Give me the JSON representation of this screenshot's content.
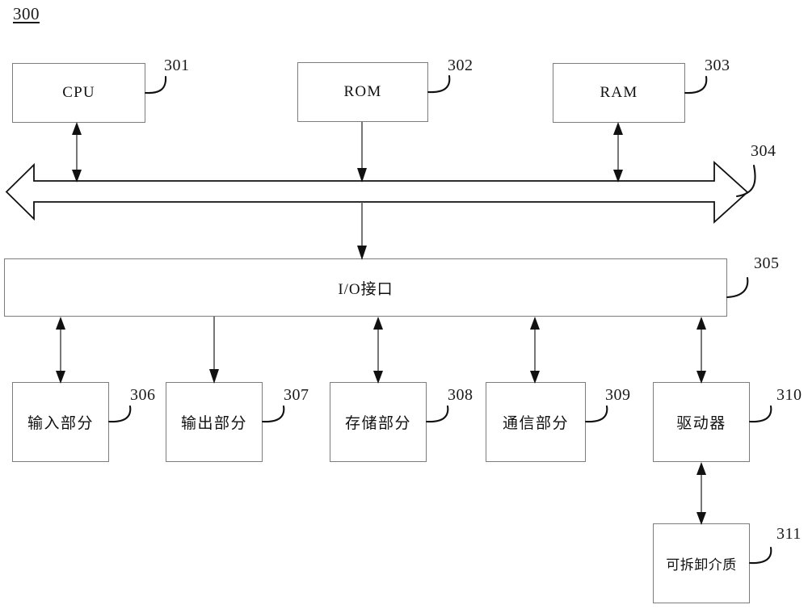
{
  "figure": {
    "number": "300",
    "caption_position": "top-left"
  },
  "nodes": [
    {
      "id": "301",
      "label": "CPU",
      "ref": "301",
      "script": "latin"
    },
    {
      "id": "302",
      "label": "ROM",
      "ref": "302",
      "script": "latin"
    },
    {
      "id": "303",
      "label": "RAM",
      "ref": "303",
      "script": "latin"
    },
    {
      "id": "304",
      "label": "",
      "ref": "304",
      "script": "bus"
    },
    {
      "id": "305",
      "label": "I/O接口",
      "ref": "305",
      "script": "mixed"
    },
    {
      "id": "306",
      "label": "输入部分",
      "ref": "306",
      "script": "cjk"
    },
    {
      "id": "307",
      "label": "输出部分",
      "ref": "307",
      "script": "cjk"
    },
    {
      "id": "308",
      "label": "存储部分",
      "ref": "308",
      "script": "cjk"
    },
    {
      "id": "309",
      "label": "通信部分",
      "ref": "309",
      "script": "cjk"
    },
    {
      "id": "310",
      "label": "驱动器",
      "ref": "310",
      "script": "cjk"
    },
    {
      "id": "311",
      "label": "可拆卸介质",
      "ref": "311",
      "script": "cjk"
    }
  ],
  "labels": {
    "cpu": "CPU",
    "rom": "ROM",
    "ram": "RAM",
    "io_interface": "I/O接口",
    "input_part": "输入部分",
    "output_part": "输出部分",
    "storage_part": "存储部分",
    "communication_part": "通信部分",
    "driver": "驱动器",
    "removable_medium": "可拆卸介质"
  },
  "refs": {
    "figure": "300",
    "cpu": "301",
    "rom": "302",
    "ram": "303",
    "bus": "304",
    "io_interface": "305",
    "input_part": "306",
    "output_part": "307",
    "storage_part": "308",
    "communication_part": "309",
    "driver": "310",
    "removable_medium": "311"
  },
  "colors": {
    "background": "#ffffff",
    "box_border": "#7d7d7d",
    "connector": "#555555",
    "text": "#111111",
    "bus_outline": "#111111"
  },
  "connections": [
    {
      "from": "cpu",
      "to": "bus",
      "type": "bidirectional"
    },
    {
      "from": "rom",
      "to": "bus",
      "type": "unidirectional-down"
    },
    {
      "from": "ram",
      "to": "bus",
      "type": "bidirectional"
    },
    {
      "from": "bus",
      "to": "io_interface",
      "type": "unidirectional-down"
    },
    {
      "from": "io_interface",
      "to": "input_part",
      "type": "bidirectional"
    },
    {
      "from": "io_interface",
      "to": "output_part",
      "type": "unidirectional-down"
    },
    {
      "from": "io_interface",
      "to": "storage_part",
      "type": "bidirectional"
    },
    {
      "from": "io_interface",
      "to": "communication_part",
      "type": "bidirectional"
    },
    {
      "from": "io_interface",
      "to": "driver",
      "type": "unidirectional-down"
    },
    {
      "from": "driver",
      "to": "removable_medium",
      "type": "bidirectional"
    }
  ]
}
